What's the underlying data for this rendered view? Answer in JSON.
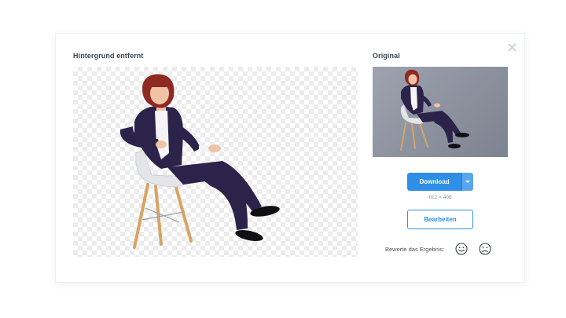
{
  "dialog": {
    "close_glyph": "×",
    "left_heading": "Hintergrund entfernt",
    "right_heading": "Original"
  },
  "actions": {
    "download_label": "Download",
    "dimensions": "612 × 408",
    "edit_label": "Bearbeiten"
  },
  "rating": {
    "label": "Bewerte das Ergebnis:",
    "icons": [
      "smiley-happy-icon",
      "smiley-sad-icon"
    ]
  },
  "colors": {
    "accent": "#2f8fe6",
    "heading": "#3d4550",
    "suit": "#2b2349",
    "chair": "#e3e5e8",
    "chair_legs": "#d7a464"
  }
}
